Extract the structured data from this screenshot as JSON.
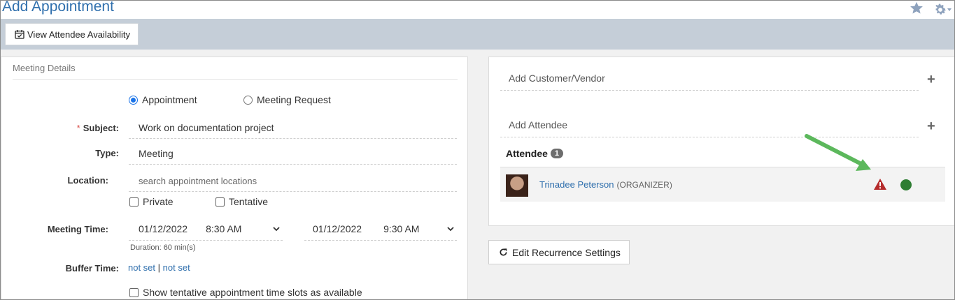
{
  "header": {
    "title": "Add Appointment"
  },
  "toolbar": {
    "availability_label": "View Attendee Availability"
  },
  "meeting": {
    "section_title": "Meeting Details",
    "radio_appointment": "Appointment",
    "radio_meeting_request": "Meeting Request",
    "subject_label": "Subject:",
    "subject_required": "*",
    "subject_value": "Work on documentation project",
    "type_label": "Type:",
    "type_value": "Meeting",
    "location_label": "Location:",
    "location_placeholder": "search appointment locations",
    "private_label": "Private",
    "tentative_label": "Tentative",
    "time_label": "Meeting Time:",
    "start_date": "01/12/2022",
    "start_time": "8:30 AM",
    "end_date": "01/12/2022",
    "end_time": "9:30 AM",
    "duration": "Duration: 60 min(s)",
    "buffer_label": "Buffer Time:",
    "buffer_before": "not set",
    "buffer_sep": "|",
    "buffer_after": "not set",
    "show_tentative_label": "Show tentative appointment time slots as available"
  },
  "right": {
    "add_customer": "Add Customer/Vendor",
    "add_attendee": "Add Attendee",
    "attendee_header": "Attendee",
    "attendee_count": "1",
    "attendee_name": "Trinadee Peterson",
    "attendee_role": "(ORGANIZER)",
    "recurrence_label": "Edit Recurrence Settings"
  },
  "colors": {
    "accent": "#2f6fad",
    "warning": "#b52b2b",
    "status_available": "#2e7d32",
    "annotation_arrow": "#5cb85c"
  },
  "icons": {
    "star": "star-icon",
    "gear": "gear-icon",
    "calendar": "calendar-check-icon",
    "warning": "warning-icon",
    "refresh": "refresh-icon"
  }
}
